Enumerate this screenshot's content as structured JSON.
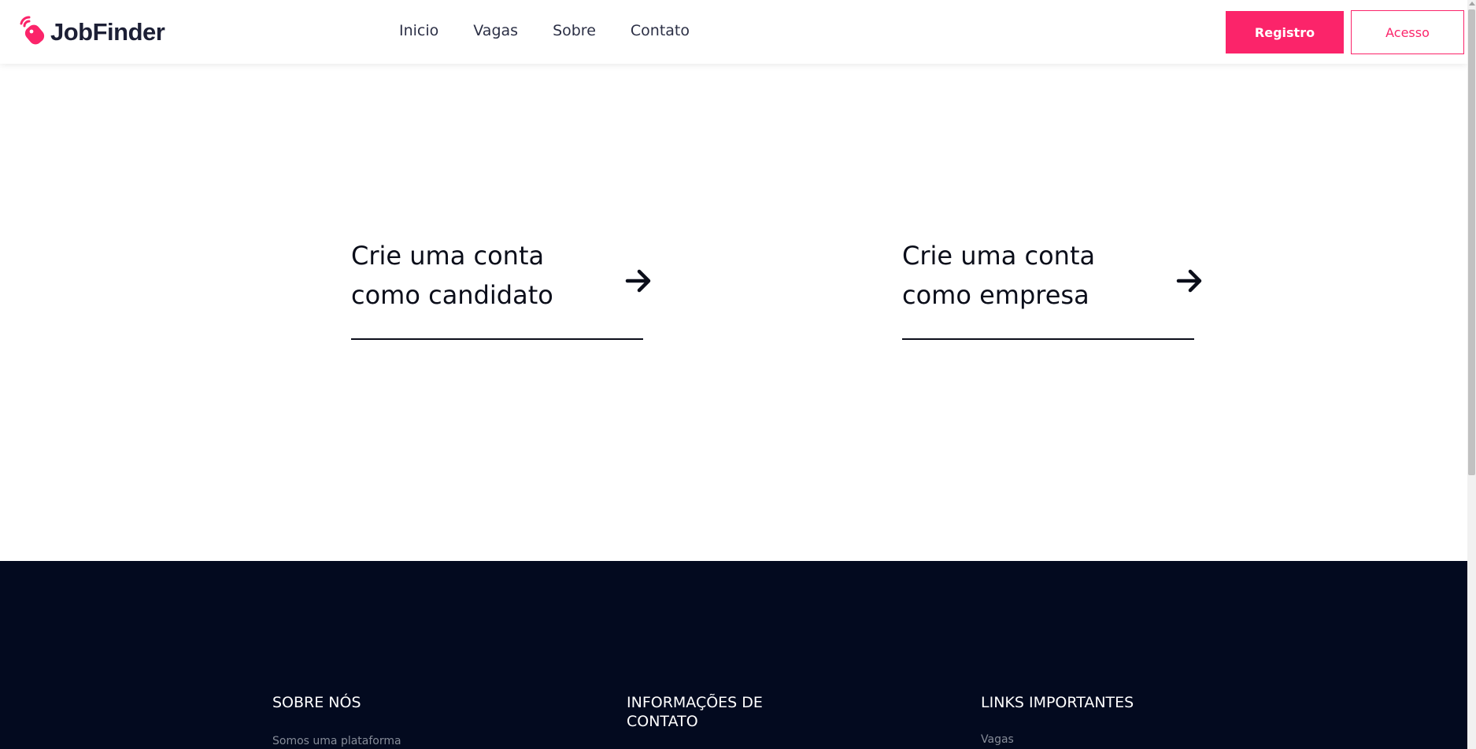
{
  "header": {
    "logo_text": "JobFinder",
    "nav": [
      {
        "label": "Inicio"
      },
      {
        "label": "Vagas"
      },
      {
        "label": "Sobre"
      },
      {
        "label": "Contato"
      }
    ],
    "register_label": "Registro",
    "login_label": "Acesso"
  },
  "main": {
    "options": [
      {
        "label": "Crie uma conta como candidato",
        "icon": "arrow-right-icon"
      },
      {
        "label": "Crie uma conta como empresa",
        "icon": "arrow-right-icon"
      }
    ]
  },
  "footer": {
    "sobre": {
      "heading": "SOBRE NÓS",
      "text": "Somos uma plataforma"
    },
    "contato": {
      "heading": "INFORMAÇÕES DE CONTATO"
    },
    "links": {
      "heading": "LINKS IMPORTANTES",
      "first_link": "Vagas"
    }
  },
  "colors": {
    "accent": "#fb246a",
    "footer_bg": "#030a1f",
    "text_dark": "#0b0e1a"
  }
}
